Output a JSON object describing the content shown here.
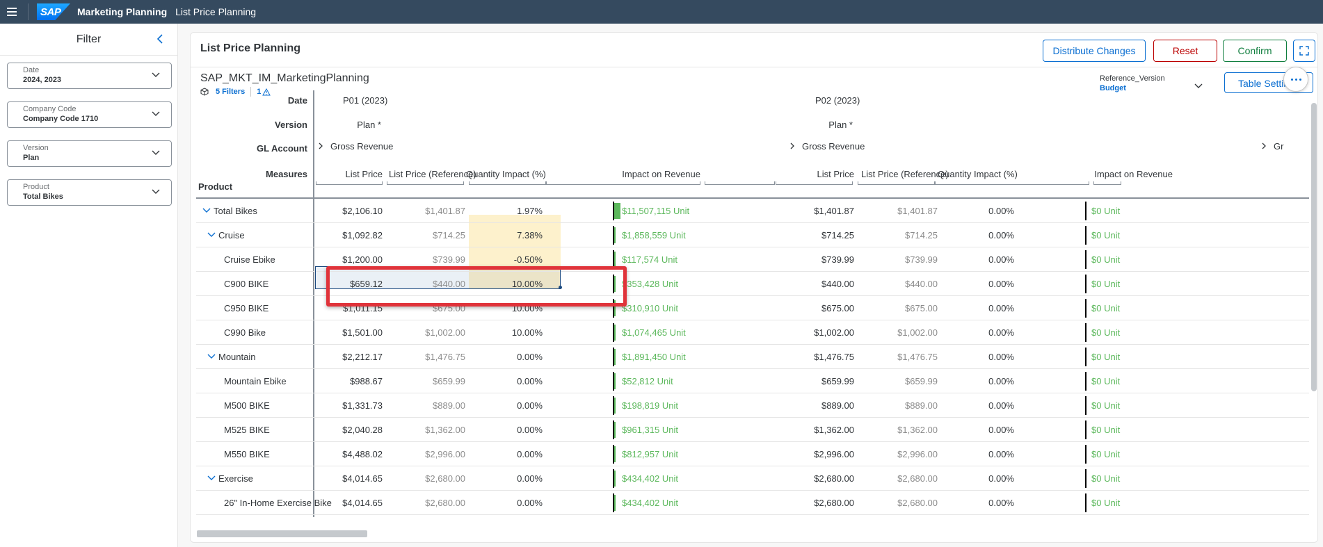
{
  "shell": {
    "logo": "SAP",
    "app_title": "Marketing Planning",
    "sub_title": "List Price Planning"
  },
  "filter": {
    "title": "Filter",
    "items": [
      {
        "label": "Date",
        "value": "2024, 2023"
      },
      {
        "label": "Company Code",
        "value": "Company Code 1710"
      },
      {
        "label": "Version",
        "value": "Plan"
      },
      {
        "label": "Product",
        "value": "Total Bikes"
      }
    ]
  },
  "card": {
    "title": "List Price Planning",
    "buttons": {
      "distribute": "Distribute Changes",
      "reset": "Reset",
      "confirm": "Confirm"
    },
    "model": "SAP_MKT_IM_MarketingPlanning",
    "filters_link": "5 Filters",
    "warnings": "1",
    "ref_version": {
      "label": "Reference_Version",
      "value": "Budget"
    },
    "table_settings": "Table Settings"
  },
  "grid": {
    "row_labels": {
      "date": "Date",
      "version": "Version",
      "gl": "GL Account",
      "measures": "Measures",
      "product": "Product"
    },
    "periods": [
      {
        "date": "P01 (2023)",
        "version": "Plan *",
        "gl": "Gross Revenue"
      },
      {
        "date": "P02 (2023)",
        "version": "Plan *",
        "gl": "Gross Revenue"
      },
      {
        "date": "",
        "version": "",
        "gl": "Gr"
      }
    ],
    "measures": [
      "List Price",
      "List Price (Reference)",
      "Quantity Impact (%)",
      "Impact on Revenue"
    ],
    "rows": [
      {
        "name": "Total Bikes",
        "lp1": "$2,106.10",
        "ref1": "$1,401.87",
        "qi1": "1.97%",
        "imp1": "$11,507,115 Unit",
        "lp2": "$1,401.87",
        "ref2": "$1,401.87",
        "qi2": "0.00%",
        "imp2": "$0 Unit"
      },
      {
        "name": "Cruise",
        "lp1": "$1,092.82",
        "ref1": "$714.25",
        "qi1": "7.38%",
        "imp1": "$1,858,559 Unit",
        "lp2": "$714.25",
        "ref2": "$714.25",
        "qi2": "0.00%",
        "imp2": "$0 Unit"
      },
      {
        "name": "Cruise Ebike",
        "lp1": "$1,200.00",
        "ref1": "$739.99",
        "qi1": "-0.50%",
        "imp1": "$117,574 Unit",
        "lp2": "$739.99",
        "ref2": "$739.99",
        "qi2": "0.00%",
        "imp2": "$0 Unit"
      },
      {
        "name": "C900 BIKE",
        "lp1": "$659.12",
        "ref1": "$440.00",
        "qi1": "10.00%",
        "imp1": "$353,428 Unit",
        "lp2": "$440.00",
        "ref2": "$440.00",
        "qi2": "0.00%",
        "imp2": "$0 Unit"
      },
      {
        "name": "C950 BIKE",
        "lp1": "$1,011.15",
        "ref1": "$675.00",
        "qi1": "10.00%",
        "imp1": "$310,910 Unit",
        "lp2": "$675.00",
        "ref2": "$675.00",
        "qi2": "0.00%",
        "imp2": "$0 Unit"
      },
      {
        "name": "C990 Bike",
        "lp1": "$1,501.00",
        "ref1": "$1,002.00",
        "qi1": "10.00%",
        "imp1": "$1,074,465 Unit",
        "lp2": "$1,002.00",
        "ref2": "$1,002.00",
        "qi2": "0.00%",
        "imp2": "$0 Unit"
      },
      {
        "name": "Mountain",
        "lp1": "$2,212.17",
        "ref1": "$1,476.75",
        "qi1": "0.00%",
        "imp1": "$1,891,450 Unit",
        "lp2": "$1,476.75",
        "ref2": "$1,476.75",
        "qi2": "0.00%",
        "imp2": "$0 Unit"
      },
      {
        "name": "Mountain Ebike",
        "lp1": "$988.67",
        "ref1": "$659.99",
        "qi1": "0.00%",
        "imp1": "$52,812 Unit",
        "lp2": "$659.99",
        "ref2": "$659.99",
        "qi2": "0.00%",
        "imp2": "$0 Unit"
      },
      {
        "name": "M500 BIKE",
        "lp1": "$1,331.73",
        "ref1": "$889.00",
        "qi1": "0.00%",
        "imp1": "$198,819 Unit",
        "lp2": "$889.00",
        "ref2": "$889.00",
        "qi2": "0.00%",
        "imp2": "$0 Unit"
      },
      {
        "name": "M525 BIKE",
        "lp1": "$2,040.28",
        "ref1": "$1,362.00",
        "qi1": "0.00%",
        "imp1": "$961,315 Unit",
        "lp2": "$1,362.00",
        "ref2": "$1,362.00",
        "qi2": "0.00%",
        "imp2": "$0 Unit"
      },
      {
        "name": "M550 BIKE",
        "lp1": "$4,488.02",
        "ref1": "$2,996.00",
        "qi1": "0.00%",
        "imp1": "$812,957 Unit",
        "lp2": "$2,996.00",
        "ref2": "$2,996.00",
        "qi2": "0.00%",
        "imp2": "$0 Unit"
      },
      {
        "name": "Exercise",
        "lp1": "$4,014.65",
        "ref1": "$2,680.00",
        "qi1": "0.00%",
        "imp1": "$434,402 Unit",
        "lp2": "$2,680.00",
        "ref2": "$2,680.00",
        "qi2": "0.00%",
        "imp2": "$0 Unit"
      },
      {
        "name": "26\" In-Home Exercise Bike",
        "lp1": "$4,014.65",
        "ref1": "$2,680.00",
        "qi1": "0.00%",
        "imp1": "$434,402 Unit",
        "lp2": "$2,680.00",
        "ref2": "$2,680.00",
        "qi2": "0.00%",
        "imp2": "$0 Unit"
      }
    ],
    "impact_fill": [
      1.0,
      0.16,
      0.01,
      0.03,
      0.027,
      0.093,
      0.164,
      0.005,
      0.017,
      0.084,
      0.071,
      0.038,
      0.038
    ]
  },
  "colors": {
    "shell": "#354a5f",
    "accent": "#0a6ed1",
    "reset": "#bb0000",
    "confirm": "#107e3e",
    "impact_green": "#5cb85c",
    "highlight": "#fdf1cc",
    "annotation": "#e0333a"
  }
}
